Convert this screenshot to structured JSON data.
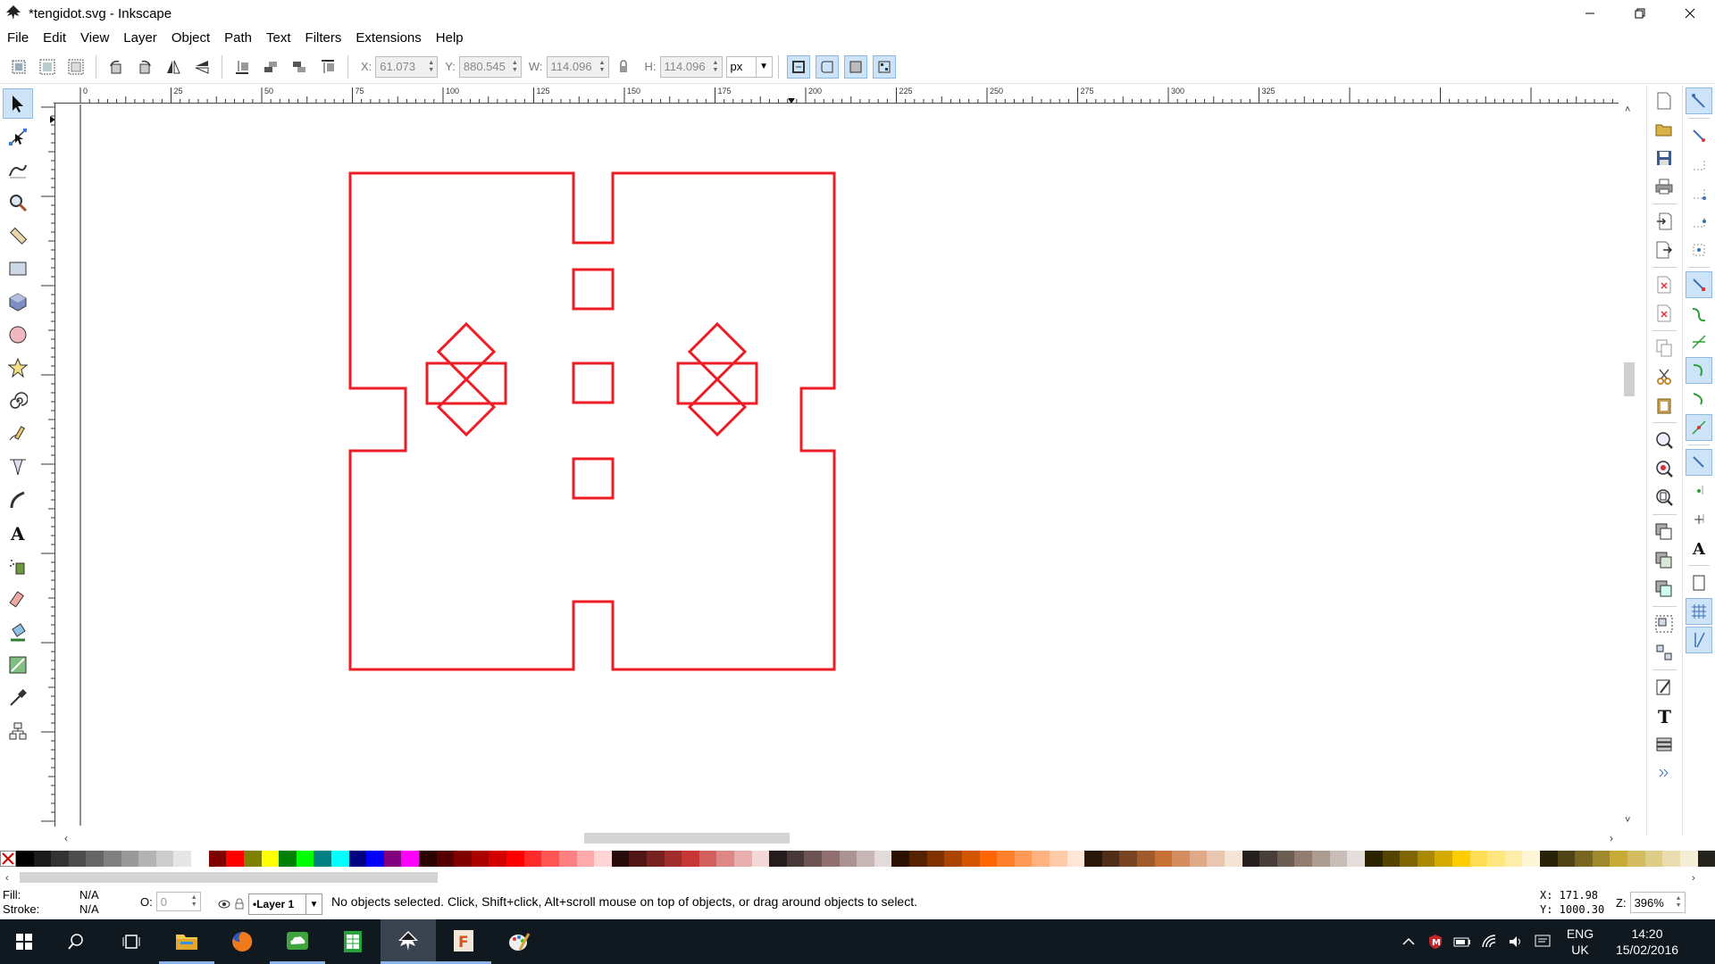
{
  "window": {
    "title": "*tengidot.svg - Inkscape"
  },
  "menu": [
    "File",
    "Edit",
    "View",
    "Layer",
    "Object",
    "Path",
    "Text",
    "Filters",
    "Extensions",
    "Help"
  ],
  "toolctrl": {
    "x_label": "X:",
    "x_value": "61.073",
    "y_label": "Y:",
    "y_value": "880.545",
    "w_label": "W:",
    "w_value": "114.096",
    "h_label": "H:",
    "h_value": "114.096",
    "unit": "px"
  },
  "ruler": {
    "h_ticks": [
      "0",
      "25",
      "50",
      "75",
      "100",
      "125",
      "150",
      "175",
      "200",
      "225",
      "250",
      "275",
      "300",
      "325"
    ]
  },
  "palette_colors": [
    "#000000",
    "#1a1a1a",
    "#333333",
    "#4d4d4d",
    "#666666",
    "#808080",
    "#999999",
    "#b3b3b3",
    "#cccccc",
    "#e6e6e6",
    "#ffffff",
    "#800000",
    "#ff0000",
    "#808000",
    "#ffff00",
    "#008000",
    "#00ff00",
    "#008080",
    "#00ffff",
    "#000080",
    "#0000ff",
    "#800080",
    "#ff00ff",
    "#2b0000",
    "#550000",
    "#800000",
    "#aa0000",
    "#d40000",
    "#ff0000",
    "#ff2a2a",
    "#ff5555",
    "#ff8080",
    "#ffaaaa",
    "#ffd5d5",
    "#280b0b",
    "#501616",
    "#782121",
    "#a02c2c",
    "#c83737",
    "#d35f5f",
    "#de8787",
    "#e9afaf",
    "#f4d7d7",
    "#241c1c",
    "#483737",
    "#6c5353",
    "#916f6f",
    "#ac9393",
    "#c8b7b7",
    "#e3dbdb",
    "#2b1100",
    "#552200",
    "#803300",
    "#aa4400",
    "#d45500",
    "#ff6600",
    "#ff7f2a",
    "#ff9955",
    "#ffb380",
    "#ffccaa",
    "#ffe6d5",
    "#28170b",
    "#502d16",
    "#784421",
    "#a05a2c",
    "#c87137",
    "#d38d5f",
    "#deaa87",
    "#e9c6af",
    "#f4e3d7",
    "#241f1c",
    "#483e37",
    "#6c5d53",
    "#917c6f",
    "#ac9d93",
    "#c8beb7",
    "#e3dedb",
    "#2b2200",
    "#554400",
    "#806600",
    "#aa8800",
    "#d4aa00",
    "#ffcc00",
    "#ffdd55",
    "#ffe680",
    "#ffeeaa",
    "#fff6d5",
    "#28220b",
    "#504416",
    "#786721",
    "#a0892c",
    "#c8ab37",
    "#d3bc5f",
    "#decd87",
    "#e9ddaf",
    "#f4eed7",
    "#24221c"
  ],
  "status": {
    "fill_label": "Fill:",
    "fill_value": "N/A",
    "stroke_label": "Stroke:",
    "stroke_value": "N/A",
    "opacity_label": "O:",
    "opacity_value": "0",
    "layer": "•Layer 1",
    "message": "No objects selected. Click, Shift+click, Alt+scroll mouse on top of objects, or drag around objects to select.",
    "cursor_x": "X:  171.98",
    "cursor_y": "Y: 1000.30",
    "zoom_label": "Z:",
    "zoom_value": "396%"
  },
  "taskbar": {
    "lang_line1": "ENG",
    "lang_line2": "UK",
    "time": "14:20",
    "date": "15/02/2016"
  },
  "colors": {
    "stroke": "#ee1c24",
    "accent": "#cde3f7"
  }
}
